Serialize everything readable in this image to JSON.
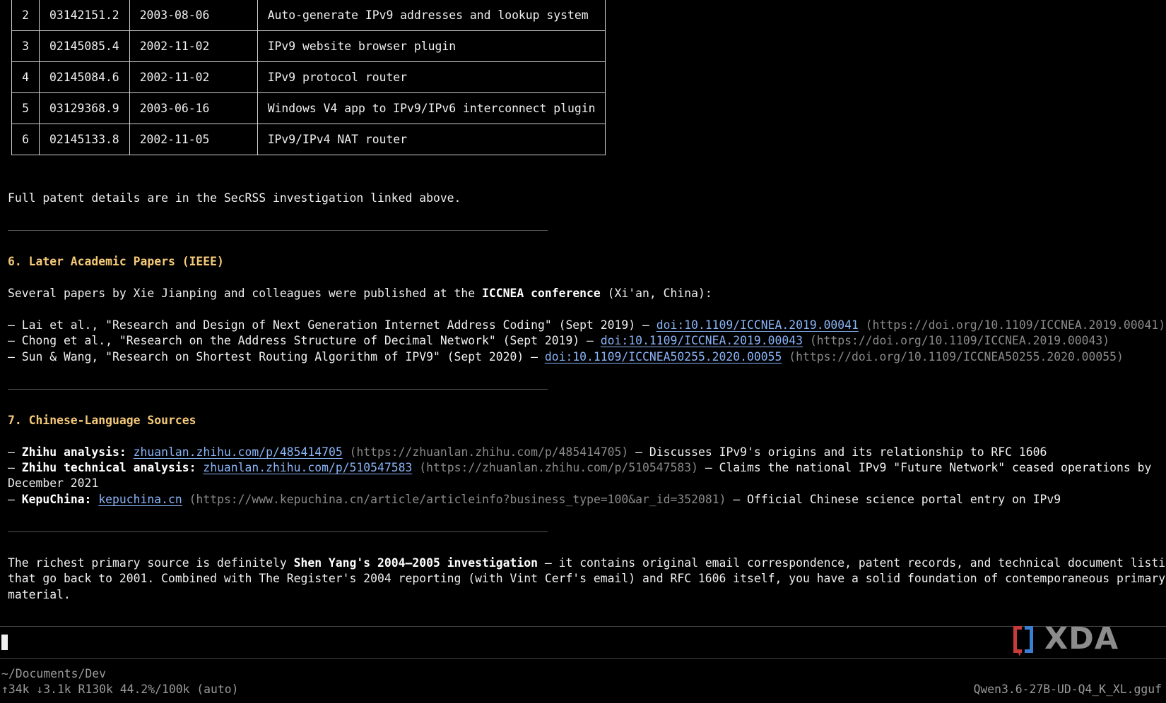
{
  "table": {
    "rows": [
      [
        "2",
        "03142151.2",
        "2003-08-06",
        "Auto-generate IPv9 addresses and lookup system"
      ],
      [
        "3",
        "02145085.4",
        "2002-11-02",
        "IPv9 website browser plugin"
      ],
      [
        "4",
        "02145084.6",
        "2002-11-02",
        "IPv9 protocol router"
      ],
      [
        "5",
        "03129368.9",
        "2003-06-16",
        "Windows V4 app to IPv9/IPv6 interconnect plugin"
      ],
      [
        "6",
        "02145133.8",
        "2002-11-05",
        "IPv9/IPv4 NAT router"
      ]
    ]
  },
  "patent_note": "Full patent details are in the SecRSS investigation linked above.",
  "section6": {
    "heading": "6. Later Academic Papers (IEEE)",
    "intro_before": "Several papers by Xie Jianping and colleagues were published at the ",
    "intro_bold": "ICCNEA conference",
    "intro_after": " (Xi'an, China):",
    "papers": [
      {
        "prefix": "– Lai et al., \"Research and Design of Next Generation Internet Address Coding\" (Sept 2019) – ",
        "link": "doi:10.1109/ICCNEA.2019.00041",
        "url": " (https://doi.org/10.1109/ICCNEA.2019.00041)"
      },
      {
        "prefix": "– Chong et al., \"Research on the Address Structure of Decimal Network\" (Sept 2019) – ",
        "link": "doi:10.1109/ICCNEA.2019.00043",
        "url": " (https://doi.org/10.1109/ICCNEA.2019.00043)"
      },
      {
        "prefix": "– Sun & Wang, \"Research on Shortest Routing Algorithm of IPV9\" (Sept 2020) – ",
        "link": "doi:10.1109/ICCNEA50255.2020.00055",
        "url": " (https://doi.org/10.1109/ICCNEA50255.2020.00055)"
      }
    ]
  },
  "section7": {
    "heading": "7. Chinese-Language Sources",
    "sources": [
      {
        "dash": "– ",
        "label": "Zhihu analysis:",
        "link": "zhuanlan.zhihu.com/p/485414705",
        "url": " (https://zhuanlan.zhihu.com/p/485414705)",
        "desc": " – Discusses IPv9's origins and its relationship to RFC 1606",
        "desc2": ""
      },
      {
        "dash": "– ",
        "label": "Zhihu technical analysis:",
        "link": "zhuanlan.zhihu.com/p/510547583",
        "url": " (https://zhuanlan.zhihu.com/p/510547583)",
        "desc": " – Claims the national IPv9 \"Future Network\" ceased operations by",
        "desc2": "December 2021"
      },
      {
        "dash": "– ",
        "label": "KepuChina:",
        "link": "kepuchina.cn",
        "url": " (https://www.kepuchina.cn/article/articleinfo?business_type=100&ar_id=352081)",
        "desc": " – Official Chinese science portal entry on IPv9",
        "desc2": ""
      }
    ]
  },
  "summary": {
    "l1_before": "The richest primary source is definitely ",
    "l1_bold": "Shen Yang's 2004–2005 investigation",
    "l1_after": " – it contains original email correspondence, patent records, and technical document listings",
    "l2": "that go back to 2001. Combined with The Register's 2004 reporting (with Vint Cerf's email) and RFC 1606 itself, you have a solid foundation of contemporaneous primary",
    "l3": "material."
  },
  "status": {
    "cwd": "~/Documents/Dev",
    "tokens": "↑34k ↓3.1k R130k 44.2%/100k (auto)",
    "model": "Qwen3.6-27B-UD-Q4_K_XL.gguf"
  },
  "watermark": {
    "text": "XDA"
  },
  "colors": {
    "background": "#000000",
    "text": "#f0f0f0",
    "heading": "#f5c978",
    "link": "#8ab4f8",
    "url": "#8a8a8a",
    "status": "#9a9a9a"
  }
}
